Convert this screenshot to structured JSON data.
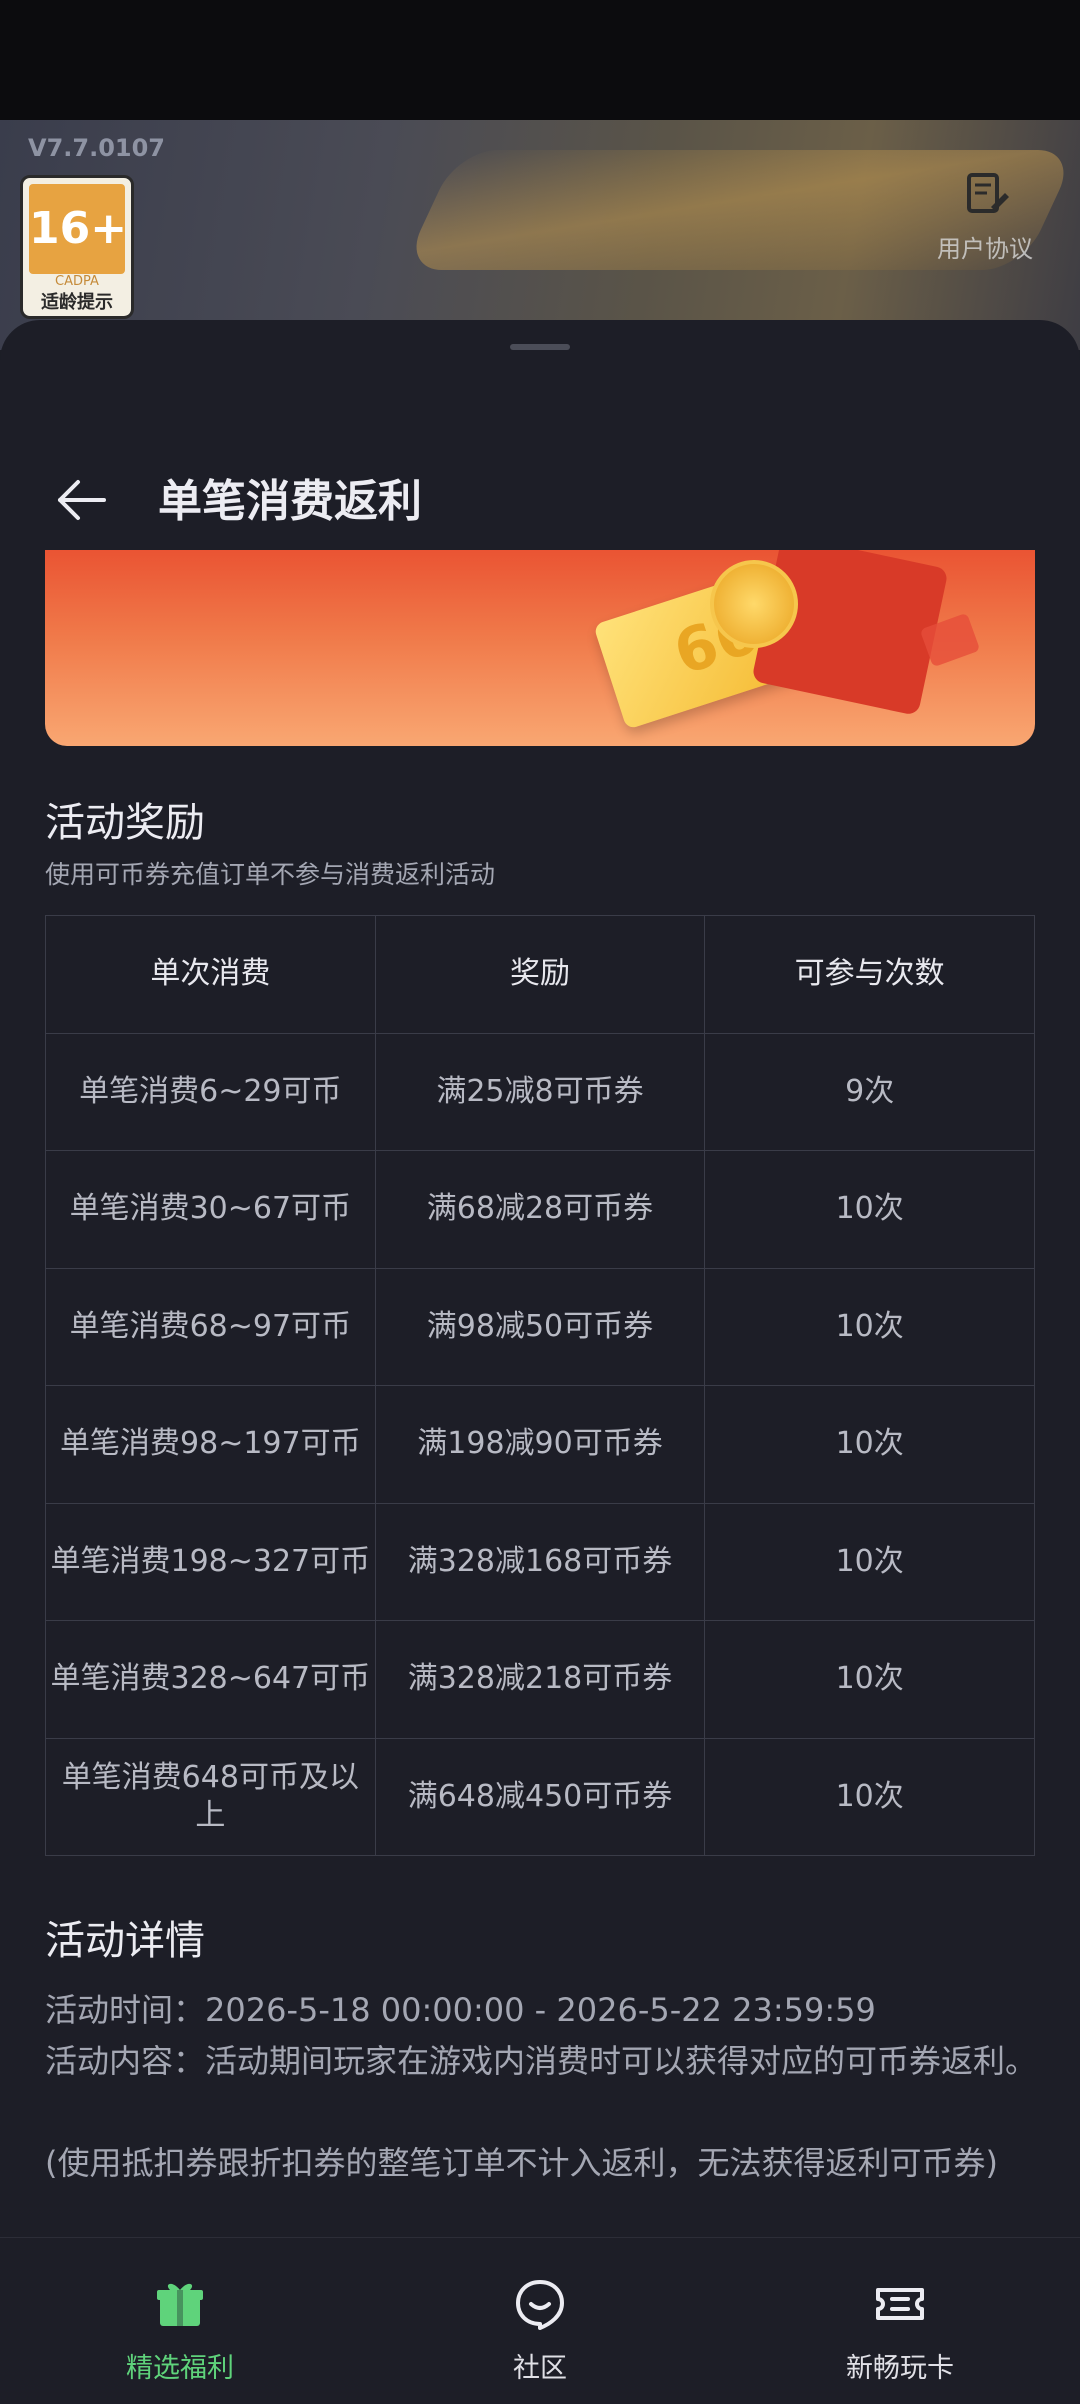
{
  "version": "V7.7.0107",
  "age_badge": {
    "age": "16+",
    "org": "CADPA",
    "tip": "适龄提示"
  },
  "agreement": {
    "label": "用户协议"
  },
  "header": {
    "title": "单笔消费返利"
  },
  "banner": {
    "coupon_text": "666"
  },
  "rewards_section": {
    "title": "活动奖励",
    "subtitle": "使用可币券充值订单不参与消费返利活动",
    "columns": [
      "单次消费",
      "奖励",
      "可参与次数"
    ],
    "rows": [
      [
        "单笔消费6~29可币",
        "满25减8可币券",
        "9次"
      ],
      [
        "单笔消费30~67可币",
        "满68减28可币券",
        "10次"
      ],
      [
        "单笔消费68~97可币",
        "满98减50可币券",
        "10次"
      ],
      [
        "单笔消费98~197可币",
        "满198减90可币券",
        "10次"
      ],
      [
        "单笔消费198~327可币",
        "满328减168可币券",
        "10次"
      ],
      [
        "单笔消费328~647可币",
        "满328减218可币券",
        "10次"
      ],
      [
        "单笔消费648可币及以上",
        "满648减450可币券",
        "10次"
      ]
    ]
  },
  "details_section": {
    "title": "活动详情",
    "time": "活动时间：2026-5-18 00:00:00 - 2026-5-22 23:59:59",
    "content": "活动内容：活动期间玩家在游戏内消费时可以获得对应的可币券返利。",
    "note": "(使用抵扣券跟折扣券的整笔订单不计入返利，无法获得返利可币券)"
  },
  "tabbar": {
    "items": [
      {
        "label": "精选福利",
        "icon": "gift-icon",
        "active": true
      },
      {
        "label": "社区",
        "icon": "community-icon",
        "active": false
      },
      {
        "label": "新畅玩卡",
        "icon": "ticket-icon",
        "active": false
      }
    ],
    "accent": "#5fd37b"
  }
}
